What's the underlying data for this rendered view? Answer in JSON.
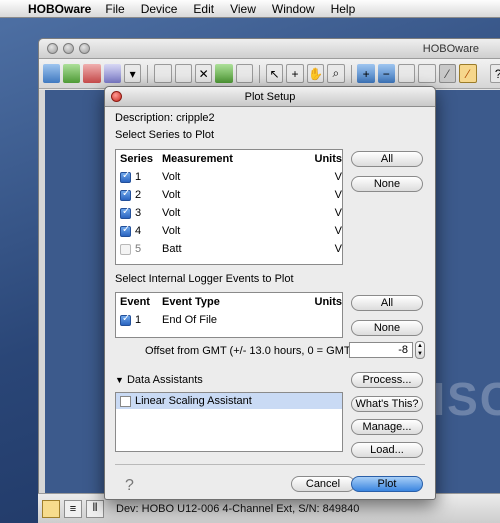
{
  "menubar": {
    "apple": "",
    "app_name": "HOBOware",
    "items": [
      "File",
      "Device",
      "Edit",
      "View",
      "Window",
      "Help"
    ]
  },
  "main_window": {
    "title": "HOBOware",
    "status": "Dev: HOBO U12-006 4-Channel Ext, S/N: 849840",
    "watermark": "DISC"
  },
  "dialog": {
    "title": "Plot Setup",
    "description": "Description: cripple2",
    "series_section_label": "Select Series to Plot",
    "series_headers": {
      "series": "Series",
      "measurement": "Measurement",
      "units": "Units"
    },
    "series": [
      {
        "num": "1",
        "measurement": "Volt",
        "units": "V",
        "checked": true
      },
      {
        "num": "2",
        "measurement": "Volt",
        "units": "V",
        "checked": true
      },
      {
        "num": "3",
        "measurement": "Volt",
        "units": "V",
        "checked": true
      },
      {
        "num": "4",
        "measurement": "Volt",
        "units": "V",
        "checked": true
      },
      {
        "num": "5",
        "measurement": "Batt",
        "units": "V",
        "checked": false
      }
    ],
    "all_label": "All",
    "none_label": "None",
    "events_section_label": "Select Internal Logger Events to Plot",
    "event_headers": {
      "event": "Event",
      "type": "Event Type",
      "units": "Units"
    },
    "events": [
      {
        "num": "1",
        "type": "End Of File",
        "units": "",
        "checked": true
      }
    ],
    "offset_label": "Offset from GMT (+/- 13.0 hours, 0 = GMT)",
    "offset_value": "-8",
    "assistants_label": "Data Assistants",
    "assistants": [
      "Linear Scaling Assistant"
    ],
    "process_label": "Process...",
    "whats_this_label": "What's This?",
    "manage_label": "Manage...",
    "load_label": "Load...",
    "cancel_label": "Cancel",
    "plot_label": "Plot",
    "help": "?"
  }
}
